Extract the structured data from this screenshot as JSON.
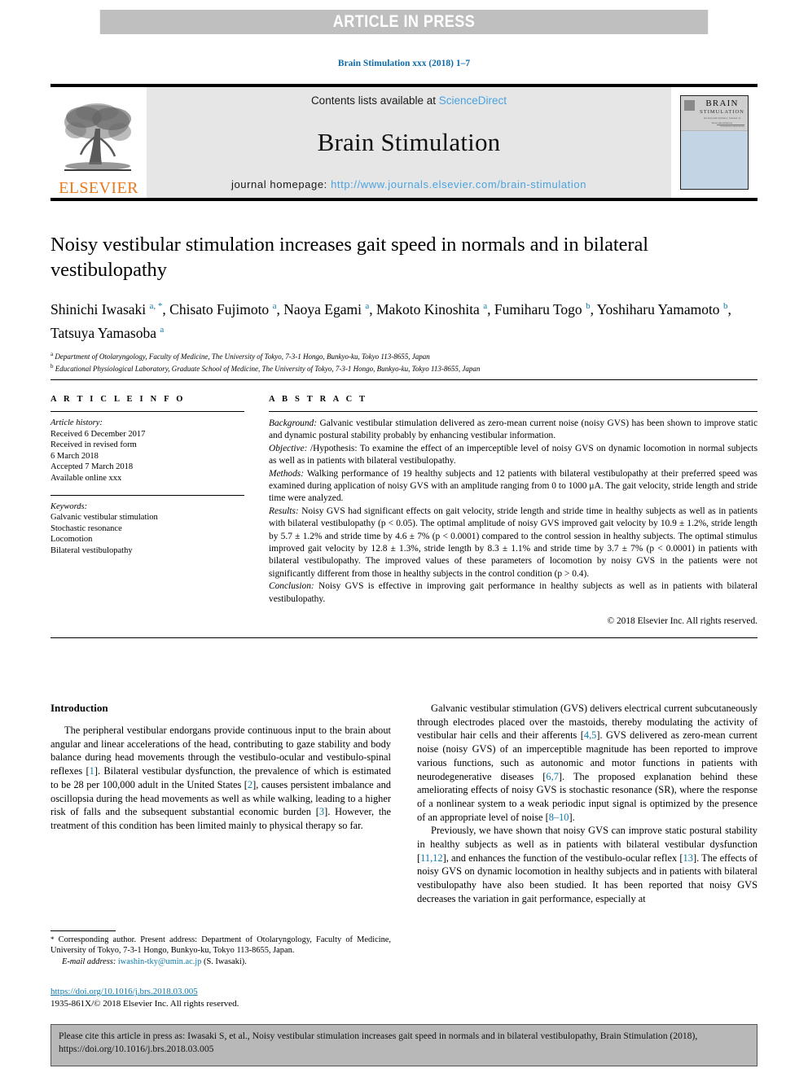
{
  "banner": {
    "text": "ARTICLE IN PRESS",
    "bg_color": "#bfbfbf",
    "text_color": "#ffffff"
  },
  "running_head": {
    "text": "Brain Stimulation xxx (2018) 1–7",
    "color": "#0e6ba8"
  },
  "masthead": {
    "publisher_name": "ELSEVIER",
    "publisher_color": "#e8791d",
    "contents_prefix": "Contents lists available at ",
    "contents_link": "ScienceDirect",
    "journal_title": "Brain Stimulation",
    "homepage_label": "journal homepage: ",
    "homepage_url": "http://www.journals.elsevier.com/brain-stimulation",
    "link_color": "#4aa3df",
    "cover": {
      "line1": "BRAIN",
      "line2": "STIMULATION",
      "line3": "An Interdisciplinary Journal of Neuromodulation",
      "line4": "www.elsevier.com/locate/brs",
      "band_color": "#cfcfcf",
      "body_color": "#c3d4e4"
    }
  },
  "article": {
    "title": "Noisy vestibular stimulation increases gait speed in normals and in bilateral vestibulopathy",
    "authors": [
      {
        "name": "Shinichi Iwasaki",
        "marks": "a, *"
      },
      {
        "name": "Chisato Fujimoto",
        "marks": "a"
      },
      {
        "name": "Naoya Egami",
        "marks": "a"
      },
      {
        "name": "Makoto Kinoshita",
        "marks": "a"
      },
      {
        "name": "Fumiharu Togo",
        "marks": "b"
      },
      {
        "name": "Yoshiharu Yamamoto",
        "marks": "b"
      },
      {
        "name": "Tatsuya Yamasoba",
        "marks": "a"
      }
    ],
    "affiliations": [
      {
        "mark": "a",
        "text": "Department of Otolaryngology, Faculty of Medicine, The University of Tokyo, 7-3-1 Hongo, Bunkyo-ku, Tokyo 113-8655, Japan"
      },
      {
        "mark": "b",
        "text": "Educational Physiological Laboratory, Graduate School of Medicine, The University of Tokyo, 7-3-1 Hongo, Bunkyo-ku, Tokyo 113-8655, Japan"
      }
    ]
  },
  "article_info": {
    "heading": "A R T I C L E   I N F O",
    "history_label": "Article history:",
    "history_lines": [
      "Received 6 December 2017",
      "Received in revised form",
      "6 March 2018",
      "Accepted 7 March 2018",
      "Available online xxx"
    ],
    "keywords_label": "Keywords:",
    "keywords": [
      "Galvanic vestibular stimulation",
      "Stochastic resonance",
      "Locomotion",
      "Bilateral vestibulopathy"
    ]
  },
  "abstract": {
    "heading": "A B S T R A C T",
    "sections": [
      {
        "label": "Background:",
        "text": " Galvanic vestibular stimulation delivered as zero-mean current noise (noisy GVS) has been shown to improve static and dynamic postural stability probably by enhancing vestibular information."
      },
      {
        "label": "Objective:",
        "text": " /Hypothesis: To examine the effect of an imperceptible level of noisy GVS on dynamic locomotion in normal subjects as well as in patients with bilateral vestibulopathy."
      },
      {
        "label": "Methods:",
        "text": " Walking performance of 19 healthy subjects and 12 patients with bilateral vestibulopathy at their preferred speed was examined during application of noisy GVS with an amplitude ranging from 0 to 1000 μA. The gait velocity, stride length and stride time were analyzed."
      },
      {
        "label": "Results:",
        "text": " Noisy GVS had significant effects on gait velocity, stride length and stride time in healthy subjects as well as in patients with bilateral vestibulopathy (p < 0.05). The optimal amplitude of noisy GVS improved gait velocity by 10.9 ± 1.2%, stride length by 5.7 ± 1.2% and stride time by 4.6 ± 7% (p < 0.0001) compared to the control session in healthy subjects. The optimal stimulus improved gait velocity by 12.8 ± 1.3%, stride length by 8.3 ± 1.1% and stride time by 3.7 ± 7% (p < 0.0001) in patients with bilateral vestibulopathy. The improved values of these parameters of locomotion by noisy GVS in the patients were not significantly different from those in healthy subjects in the control condition (p > 0.4)."
      },
      {
        "label": "Conclusion:",
        "text": " Noisy GVS is effective in improving gait performance in healthy subjects as well as in patients with bilateral vestibulopathy."
      }
    ],
    "copyright": "© 2018 Elsevier Inc. All rights reserved."
  },
  "body": {
    "intro_heading": "Introduction",
    "left_paragraph_parts": [
      "The peripheral vestibular endorgans provide continuous input to the brain about angular and linear accelerations of the head, contributing to gaze stability and body balance during head movements through the vestibulo-ocular and vestibulo-spinal reflexes [",
      "1",
      "]. Bilateral vestibular dysfunction, the prevalence of which is estimated to be 28 per 100,000 adult in the United States [",
      "2",
      "], causes persistent imbalance and oscillopsia during the head movements as well as while walking, leading to a higher risk of falls and the subsequent substantial economic burden [",
      "3",
      "]. However, the treatment of this condition has been limited mainly to physical therapy so far."
    ],
    "right_paragraph1_parts": [
      "Galvanic vestibular stimulation (GVS) delivers electrical current subcutaneously through electrodes placed over the mastoids, thereby modulating the activity of vestibular hair cells and their afferents [",
      "4,5",
      "]. GVS delivered as zero-mean current noise (noisy GVS) of an imperceptible magnitude has been reported to improve various functions, such as autonomic and motor functions in patients with neurodegenerative diseases [",
      "6,7",
      "]. The proposed explanation behind these ameliorating effects of noisy GVS is stochastic resonance (SR), where the response of a nonlinear system to a weak periodic input signal is optimized by the presence of an appropriate level of noise [",
      "8–10",
      "]."
    ],
    "right_paragraph2_parts": [
      "Previously, we have shown that noisy GVS can improve static postural stability in healthy subjects as well as in patients with bilateral vestibular dysfunction [",
      "11,12",
      "], and enhances the function of the vestibulo-ocular reflex [",
      "13",
      "]. The effects of noisy GVS on dynamic locomotion in healthy subjects and in patients with bilateral vestibulopathy have also been studied. It has been reported that noisy GVS decreases the variation in gait performance, especially at"
    ]
  },
  "footnote": {
    "star": "*",
    "corresponding_text": " Corresponding author. Present address: Department of Otolaryngology, Faculty of Medicine, University of Tokyo, 7-3-1 Hongo, Bunkyo-ku, Tokyo 113-8655, Japan.",
    "email_label": "E-mail address:",
    "email": "iwashin-tky@umin.ac.jp",
    "email_owner": "(S. Iwasaki)."
  },
  "doi": {
    "url": "https://doi.org/10.1016/j.brs.2018.03.005",
    "issn_line": "1935-861X/© 2018 Elsevier Inc. All rights reserved."
  },
  "cite_box": {
    "text": "Please cite this article in press as: Iwasaki S, et al., Noisy vestibular stimulation increases gait speed in normals and in bilateral vestibulopathy, Brain Stimulation (2018), https://doi.org/10.1016/j.brs.2018.03.005",
    "bg_color": "#b8b8b8"
  }
}
